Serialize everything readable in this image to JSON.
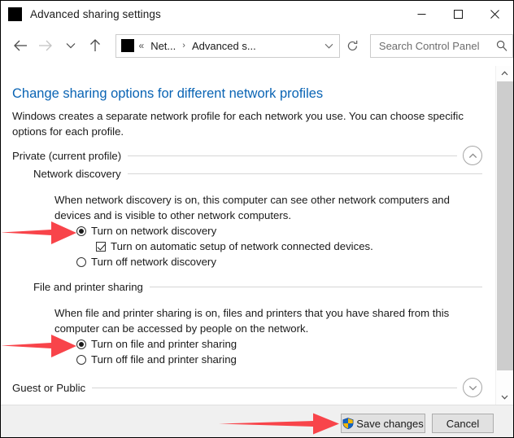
{
  "window": {
    "title": "Advanced sharing settings",
    "icon": "app-icon-redacted",
    "controls": {
      "minimize": "minimize-icon",
      "maximize": "maximize-icon",
      "close": "close-icon"
    }
  },
  "navbar": {
    "back": "back-arrow-icon",
    "forward": "forward-arrow-icon",
    "recent": "chevron-down-icon",
    "up": "up-arrow-icon",
    "address": {
      "icon": "folder-icon-redacted",
      "overflow": "«",
      "segments": [
        "Net...",
        "Advanced s..."
      ],
      "separator": "›",
      "dropdown": "chevron-down-icon",
      "refresh": "refresh-icon"
    },
    "search": {
      "placeholder": "Search Control Panel",
      "value": "",
      "icon": "search-icon"
    }
  },
  "content": {
    "heading": "Change sharing options for different network profiles",
    "intro": "Windows creates a separate network profile for each network you use. You can choose specific options for each profile.",
    "profiles": [
      {
        "label": "Private (current profile)",
        "expanded": true,
        "toggle_icon": "chevron-up-icon"
      },
      {
        "label": "Guest or Public",
        "expanded": false,
        "toggle_icon": "chevron-down-icon"
      }
    ],
    "sections": [
      {
        "title": "Network discovery",
        "description": "When network discovery is on, this computer can see other network computers and devices and is visible to other network computers.",
        "options": [
          {
            "label": "Turn on network discovery",
            "type": "radio",
            "checked": true
          },
          {
            "label": "Turn on automatic setup of network connected devices.",
            "type": "checkbox",
            "checked": true,
            "indented": true
          },
          {
            "label": "Turn off network discovery",
            "type": "radio",
            "checked": false
          }
        ]
      },
      {
        "title": "File and printer sharing",
        "description": "When file and printer sharing is on, files and printers that you have shared from this computer can be accessed by people on the network.",
        "options": [
          {
            "label": "Turn on file and printer sharing",
            "type": "radio",
            "checked": true
          },
          {
            "label": "Turn off file and printer sharing",
            "type": "radio",
            "checked": false
          }
        ]
      }
    ]
  },
  "footer": {
    "save_label": "Save changes",
    "save_icon": "uac-shield-icon",
    "cancel_label": "Cancel"
  },
  "scrollbar": {
    "up_icon": "chevron-up-icon",
    "down_icon": "chevron-down-icon"
  },
  "annotations": {
    "color": "#f8444a",
    "arrows": [
      "arrow-network-discovery-on",
      "arrow-file-printer-sharing-on",
      "arrow-save-changes"
    ]
  }
}
